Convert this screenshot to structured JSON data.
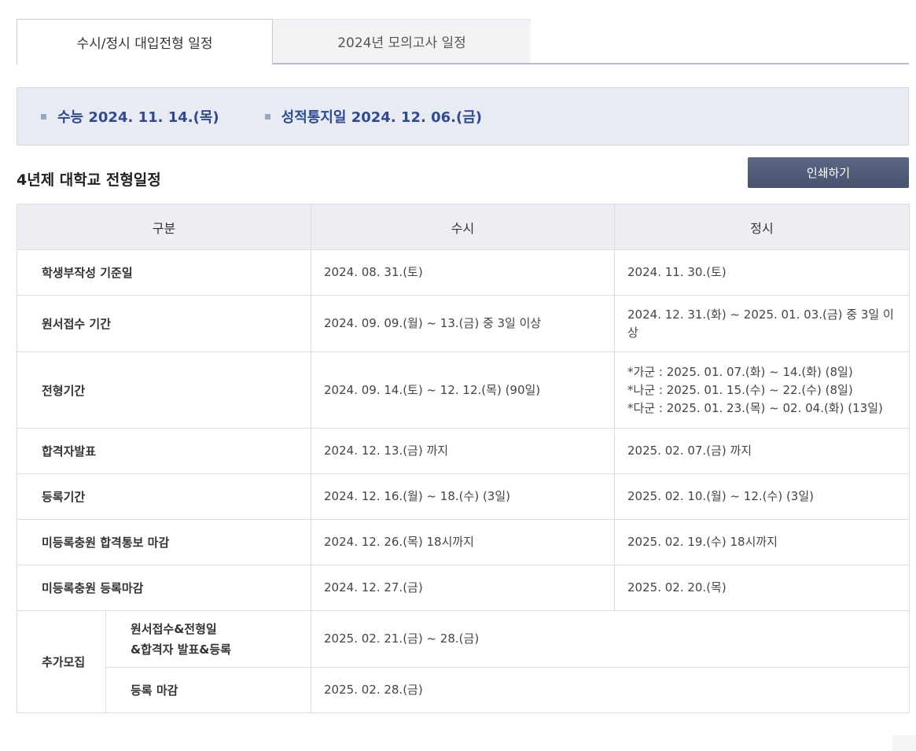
{
  "tabs": {
    "active": "수시/정시 대입전형 일정",
    "inactive": "2024년 모의고사 일정"
  },
  "info": {
    "items": [
      "수능 2024. 11. 14.(목)",
      "성적통지일 2024. 12. 06.(금)"
    ]
  },
  "section": {
    "title": "4년제 대학교 전형일정",
    "print_label": "인쇄하기"
  },
  "table": {
    "headers": [
      "구분",
      "수시",
      "정시"
    ],
    "rows": [
      {
        "label": "학생부작성 기준일",
        "susi": "2024. 08. 31.(토)",
        "jeongsi": "2024. 11. 30.(토)"
      },
      {
        "label": "원서접수 기간",
        "susi": "2024. 09. 09.(월) ~ 13.(금) 중 3일 이상",
        "jeongsi": "2024. 12. 31.(화) ~ 2025. 01. 03.(금) 중 3일 이상"
      },
      {
        "label": "전형기간",
        "susi": "2024. 09. 14.(토) ~ 12. 12.(목) (90일)",
        "jeongsi_lines": [
          "*가군 : 2025. 01. 07.(화) ~ 14.(화) (8일)",
          "*나군 : 2025. 01. 15.(수) ~ 22.(수) (8일)",
          "*다군 : 2025. 01. 23.(목) ~ 02. 04.(화) (13일)"
        ]
      },
      {
        "label": "합격자발표",
        "susi": "2024. 12. 13.(금) 까지",
        "jeongsi": "2025. 02. 07.(금) 까지"
      },
      {
        "label": "등록기간",
        "susi": "2024. 12. 16.(월) ~ 18.(수) (3일)",
        "jeongsi": "2025. 02. 10.(월) ~ 12.(수) (3일)"
      },
      {
        "label": "미등록충원 합격통보 마감",
        "susi": "2024. 12. 26.(목) 18시까지",
        "jeongsi": "2025. 02. 19.(수) 18시까지"
      },
      {
        "label": "미등록충원 등록마감",
        "susi": "2024. 12. 27.(금)",
        "jeongsi": "2025. 02. 20.(목)"
      }
    ],
    "extra": {
      "label": "추가모집",
      "sub1_lines": [
        "원서접수&전형일",
        "&합격자 발표&등록"
      ],
      "sub1_value": "2025. 02. 21.(금) ~ 28.(금)",
      "sub2": "등록 마감",
      "sub2_value": "2025. 02. 28.(금)"
    }
  }
}
